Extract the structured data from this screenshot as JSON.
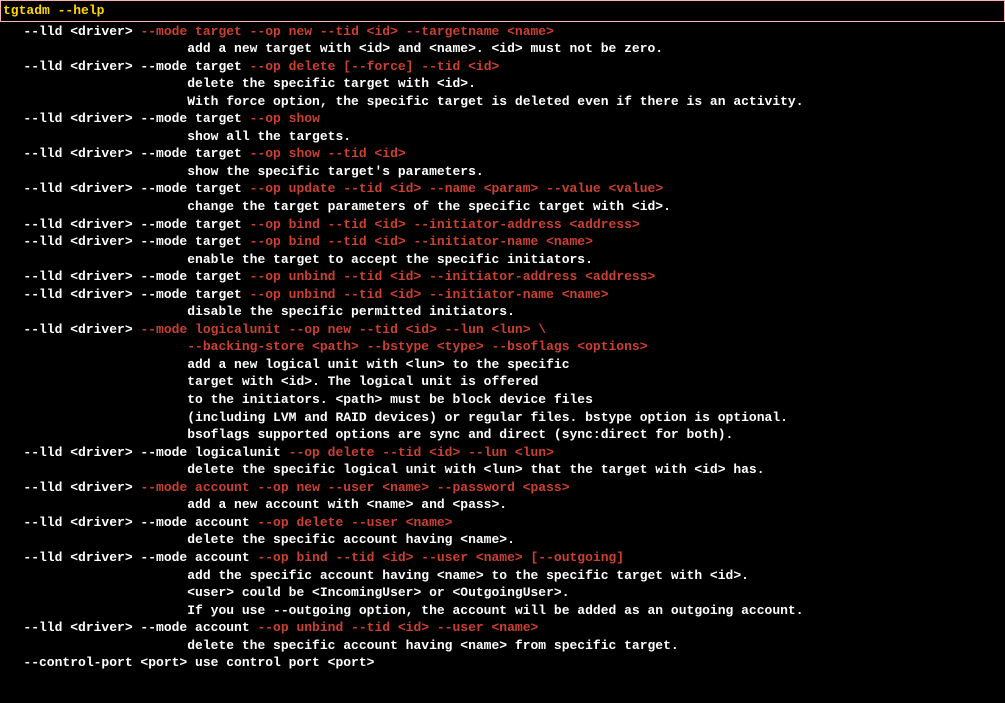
{
  "header": {
    "command": "tgtadm --help"
  },
  "lines": [
    {
      "indent": "   ",
      "segs": [
        {
          "c": "w",
          "t": "--lld <driver> "
        },
        {
          "c": "r",
          "t": "--mode target --op new --tid <id> --targetname <name>"
        }
      ]
    },
    {
      "indent": "                        ",
      "segs": [
        {
          "c": "w",
          "t": "add a new target with <id> and <name>. <id> must not be zero."
        }
      ]
    },
    {
      "indent": "   ",
      "segs": [
        {
          "c": "w",
          "t": "--lld <driver> --mode target "
        },
        {
          "c": "r",
          "t": "--op delete [--force] --tid <id>"
        }
      ]
    },
    {
      "indent": "                        ",
      "segs": [
        {
          "c": "w",
          "t": "delete the specific target with <id>."
        }
      ]
    },
    {
      "indent": "                        ",
      "segs": [
        {
          "c": "w",
          "t": "With force option, the specific target is deleted even if there is an activity."
        }
      ]
    },
    {
      "indent": "   ",
      "segs": [
        {
          "c": "w",
          "t": "--lld <driver> --mode target "
        },
        {
          "c": "r",
          "t": "--op show"
        }
      ]
    },
    {
      "indent": "                        ",
      "segs": [
        {
          "c": "w",
          "t": "show all the targets."
        }
      ]
    },
    {
      "indent": "   ",
      "segs": [
        {
          "c": "w",
          "t": "--lld <driver> --mode target "
        },
        {
          "c": "r",
          "t": "--op show --tid <id>"
        }
      ]
    },
    {
      "indent": "                        ",
      "segs": [
        {
          "c": "w",
          "t": "show the specific target's parameters."
        }
      ]
    },
    {
      "indent": "   ",
      "segs": [
        {
          "c": "w",
          "t": "--lld <driver> --mode target "
        },
        {
          "c": "r",
          "t": "--op update --tid <id> --name <param> --value <value>"
        }
      ]
    },
    {
      "indent": "                        ",
      "segs": [
        {
          "c": "w",
          "t": "change the target parameters of the specific target with <id>."
        }
      ]
    },
    {
      "indent": "   ",
      "segs": [
        {
          "c": "w",
          "t": "--lld <driver> --mode target "
        },
        {
          "c": "r",
          "t": "--op bind --tid <id> --initiator-address <address>"
        }
      ]
    },
    {
      "indent": "   ",
      "segs": [
        {
          "c": "w",
          "t": "--lld <driver> --mode target "
        },
        {
          "c": "r",
          "t": "--op bind --tid <id> --initiator-name <name>"
        }
      ]
    },
    {
      "indent": "                        ",
      "segs": [
        {
          "c": "w",
          "t": "enable the target to accept the specific initiators."
        }
      ]
    },
    {
      "indent": "   ",
      "segs": [
        {
          "c": "w",
          "t": "--lld <driver> --mode target "
        },
        {
          "c": "r",
          "t": "--op unbind --tid <id> --initiator-address <address>"
        }
      ]
    },
    {
      "indent": "   ",
      "segs": [
        {
          "c": "w",
          "t": "--lld <driver> --mode target "
        },
        {
          "c": "r",
          "t": "--op unbind --tid <id> --initiator-name <name>"
        }
      ]
    },
    {
      "indent": "                        ",
      "segs": [
        {
          "c": "w",
          "t": "disable the specific permitted initiators."
        }
      ]
    },
    {
      "indent": "   ",
      "segs": [
        {
          "c": "w",
          "t": "--lld <driver> "
        },
        {
          "c": "r",
          "t": "--mode logicalunit --op new --tid <id> --lun <lun> \\"
        }
      ]
    },
    {
      "indent": "                        ",
      "segs": [
        {
          "c": "r",
          "t": "--backing-store <path> --bstype <type> --bsoflags <options>"
        }
      ]
    },
    {
      "indent": "                        ",
      "segs": [
        {
          "c": "w",
          "t": "add a new logical unit with <lun> to the specific"
        }
      ]
    },
    {
      "indent": "                        ",
      "segs": [
        {
          "c": "w",
          "t": "target with <id>. The logical unit is offered"
        }
      ]
    },
    {
      "indent": "                        ",
      "segs": [
        {
          "c": "w",
          "t": "to the initiators. <path> must be block device files"
        }
      ]
    },
    {
      "indent": "                        ",
      "segs": [
        {
          "c": "w",
          "t": "(including LVM and RAID devices) or regular files. bstype option is optional."
        }
      ]
    },
    {
      "indent": "                        ",
      "segs": [
        {
          "c": "w",
          "t": "bsoflags supported options are sync and direct (sync:direct for both)."
        }
      ]
    },
    {
      "indent": "   ",
      "segs": [
        {
          "c": "w",
          "t": "--lld <driver> --mode logicalunit "
        },
        {
          "c": "r",
          "t": "--op delete --tid <id> --lun <lun>"
        }
      ]
    },
    {
      "indent": "                        ",
      "segs": [
        {
          "c": "w",
          "t": "delete the specific logical unit with <lun> that the target with <id> has."
        }
      ]
    },
    {
      "indent": "   ",
      "segs": [
        {
          "c": "w",
          "t": "--lld <driver> "
        },
        {
          "c": "r",
          "t": "--mode account --op new --user <name> --password <pass>"
        }
      ]
    },
    {
      "indent": "                        ",
      "segs": [
        {
          "c": "w",
          "t": "add a new account with <name> and <pass>."
        }
      ]
    },
    {
      "indent": "   ",
      "segs": [
        {
          "c": "w",
          "t": "--lld <driver> --mode account "
        },
        {
          "c": "r",
          "t": "--op delete --user <name>"
        }
      ]
    },
    {
      "indent": "                        ",
      "segs": [
        {
          "c": "w",
          "t": "delete the specific account having <name>."
        }
      ]
    },
    {
      "indent": "   ",
      "segs": [
        {
          "c": "w",
          "t": "--lld <driver> --mode account "
        },
        {
          "c": "r",
          "t": "--op bind --tid <id> --user <name> [--outgoing]"
        }
      ]
    },
    {
      "indent": "                        ",
      "segs": [
        {
          "c": "w",
          "t": "add the specific account having <name> to the specific target with <id>."
        }
      ]
    },
    {
      "indent": "                        ",
      "segs": [
        {
          "c": "w",
          "t": "<user> could be <IncomingUser> or <OutgoingUser>."
        }
      ]
    },
    {
      "indent": "                        ",
      "segs": [
        {
          "c": "w",
          "t": "If you use --outgoing option, the account will be added as an outgoing account."
        }
      ]
    },
    {
      "indent": "   ",
      "segs": [
        {
          "c": "w",
          "t": "--lld <driver> --mode account "
        },
        {
          "c": "r",
          "t": "--op unbind --tid <id> --user <name>"
        }
      ]
    },
    {
      "indent": "                        ",
      "segs": [
        {
          "c": "w",
          "t": "delete the specific account having <name> from specific target."
        }
      ]
    },
    {
      "indent": "   ",
      "segs": [
        {
          "c": "w",
          "t": "--control-port <port> use control port <port>"
        }
      ]
    }
  ]
}
